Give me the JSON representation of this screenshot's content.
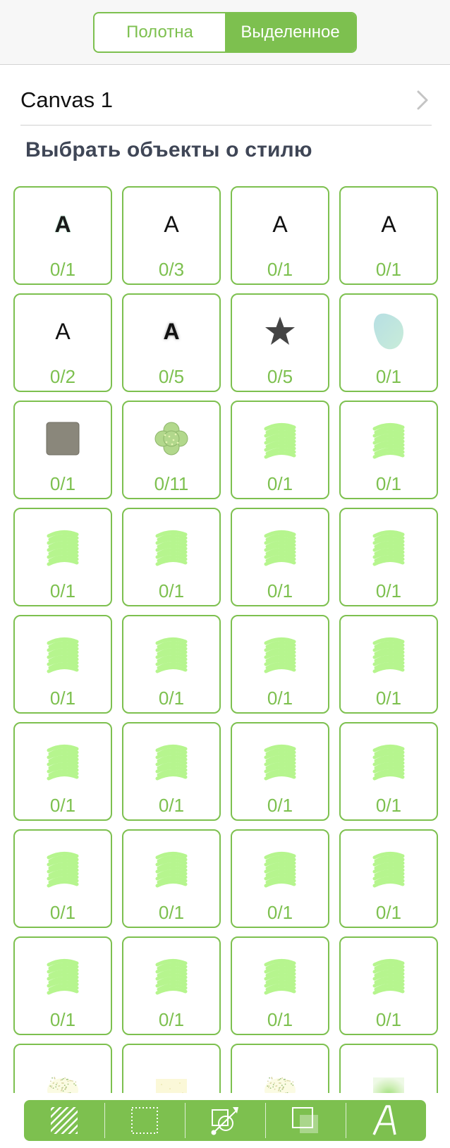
{
  "segmented": {
    "canvases_label": "Полотна",
    "selection_label": "Выделенное",
    "active": "selection"
  },
  "canvas_row": {
    "title": "Canvas 1",
    "chevron_icon": "chevron-right-icon"
  },
  "section_title": "Выбрать объекты о стилю",
  "colors": {
    "accent": "#7dc04f",
    "scribble": "#b6f58e",
    "section_text": "#3f4656"
  },
  "styles": [
    {
      "icon": "text-a-bold-icon",
      "count": "0/1"
    },
    {
      "icon": "text-a-icon",
      "count": "0/3"
    },
    {
      "icon": "text-a-icon",
      "count": "0/1"
    },
    {
      "icon": "text-a-icon",
      "count": "0/1"
    },
    {
      "icon": "text-a-icon",
      "count": "0/2"
    },
    {
      "icon": "text-a-shadow-icon",
      "count": "0/5"
    },
    {
      "icon": "star-icon",
      "count": "0/5"
    },
    {
      "icon": "blob-icon",
      "count": "0/1"
    },
    {
      "icon": "gray-square-icon",
      "count": "0/1"
    },
    {
      "icon": "flower-icon",
      "count": "0/11"
    },
    {
      "icon": "scribble-icon",
      "count": "0/1"
    },
    {
      "icon": "scribble-icon",
      "count": "0/1"
    },
    {
      "icon": "scribble-icon",
      "count": "0/1"
    },
    {
      "icon": "scribble-icon",
      "count": "0/1"
    },
    {
      "icon": "scribble-icon",
      "count": "0/1"
    },
    {
      "icon": "scribble-icon",
      "count": "0/1"
    },
    {
      "icon": "scribble-icon",
      "count": "0/1"
    },
    {
      "icon": "scribble-icon",
      "count": "0/1"
    },
    {
      "icon": "scribble-icon",
      "count": "0/1"
    },
    {
      "icon": "scribble-icon",
      "count": "0/1"
    },
    {
      "icon": "scribble-icon",
      "count": "0/1"
    },
    {
      "icon": "scribble-icon",
      "count": "0/1"
    },
    {
      "icon": "scribble-icon",
      "count": "0/1"
    },
    {
      "icon": "scribble-icon",
      "count": "0/1"
    },
    {
      "icon": "scribble-icon",
      "count": "0/1"
    },
    {
      "icon": "scribble-icon",
      "count": "0/1"
    },
    {
      "icon": "scribble-icon",
      "count": "0/1"
    },
    {
      "icon": "scribble-icon",
      "count": "0/1"
    },
    {
      "icon": "scribble-icon",
      "count": "0/1"
    },
    {
      "icon": "scribble-icon",
      "count": "0/1"
    },
    {
      "icon": "scribble-icon",
      "count": "0/1"
    },
    {
      "icon": "scribble-icon",
      "count": "0/1"
    },
    {
      "icon": "speckle-icon",
      "count": ""
    },
    {
      "icon": "pale-square-icon",
      "count": ""
    },
    {
      "icon": "speckle-icon",
      "count": ""
    },
    {
      "icon": "gradient-square-icon",
      "count": ""
    }
  ],
  "toolbar": [
    {
      "name": "fill-style-button",
      "icon": "hatch-fill-icon"
    },
    {
      "name": "stroke-style-button",
      "icon": "dotted-rect-icon"
    },
    {
      "name": "transform-button",
      "icon": "shape-transform-icon"
    },
    {
      "name": "shadow-button",
      "icon": "shadow-square-icon"
    },
    {
      "name": "text-style-button",
      "icon": "italic-a-icon"
    }
  ]
}
